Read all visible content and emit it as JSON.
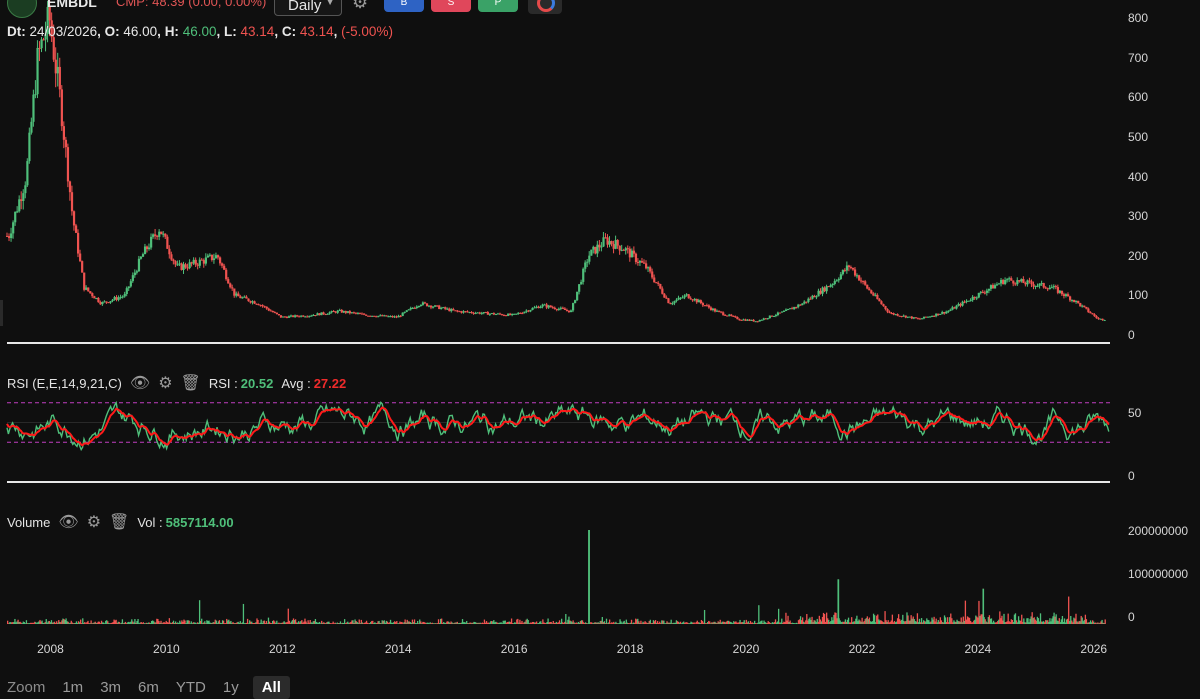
{
  "header": {
    "symbol": "EMBDL",
    "cmp_text": "CMP: 48.39 (0.00, 0.00%)",
    "timeframe": "Daily",
    "buttons": [
      "B",
      "S",
      "P"
    ]
  },
  "ohlc": {
    "dt_label": "Dt:",
    "dt": "24/03/2026",
    "o_label": "O:",
    "o": "46.00",
    "h_label": "H:",
    "h": "46.00",
    "l_label": "L:",
    "l": "43.14",
    "c_label": "C:",
    "c": "43.14",
    "change": "(-5.00%)"
  },
  "rsi": {
    "label": "RSI (E,E,14,9,21,C)",
    "value_label": "RSI :",
    "value": "20.52",
    "avg_label": "Avg :",
    "avg": "27.22"
  },
  "volume": {
    "label": "Volume",
    "value_label": "Vol :",
    "value": "5857114.00"
  },
  "zoom": {
    "label": "Zoom",
    "options": [
      "1m",
      "3m",
      "6m",
      "YTD",
      "1y",
      "All"
    ],
    "active": "All"
  },
  "colors": {
    "up": "#4fbf7a",
    "down": "#ef5350",
    "rsi_line": "#ff1a1a",
    "band": "#c03fc0"
  },
  "chart_data": [
    {
      "type": "line",
      "title": "EMBDL price",
      "x": [
        2007.3,
        2007.6,
        2007.8,
        2008.0,
        2008.2,
        2008.4,
        2008.6,
        2008.9,
        2009.3,
        2009.6,
        2009.9,
        2010.2,
        2010.5,
        2010.9,
        2011.2,
        2011.6,
        2012.0,
        2012.5,
        2013.0,
        2013.5,
        2014.0,
        2014.4,
        2015.0,
        2015.5,
        2016.0,
        2016.5,
        2017.0,
        2017.3,
        2017.6,
        2017.9,
        2018.3,
        2018.7,
        2019.0,
        2019.5,
        2019.9,
        2020.2,
        2020.7,
        2021.0,
        2021.5,
        2021.8,
        2022.1,
        2022.5,
        2023.0,
        2023.5,
        2024.0,
        2024.5,
        2024.9,
        2025.3,
        2025.7,
        2026.1
      ],
      "y": [
        250,
        400,
        700,
        800,
        580,
        300,
        120,
        80,
        100,
        200,
        270,
        170,
        180,
        200,
        100,
        80,
        45,
        50,
        60,
        50,
        45,
        80,
        60,
        55,
        50,
        75,
        60,
        200,
        240,
        220,
        170,
        80,
        100,
        60,
        40,
        35,
        60,
        80,
        130,
        175,
        120,
        55,
        40,
        60,
        100,
        140,
        130,
        120,
        85,
        40
      ],
      "ylim": [
        0,
        850
      ],
      "yticks": [
        "0",
        "100",
        "200",
        "300",
        "400",
        "500",
        "600",
        "700",
        "800"
      ]
    },
    {
      "type": "line",
      "title": "RSI",
      "yticks": [
        "0",
        "50"
      ],
      "bands": [
        30,
        70
      ],
      "ylim": [
        0,
        100
      ]
    },
    {
      "type": "bar",
      "title": "Volume",
      "yticks": [
        "0",
        "100000000",
        "200000000"
      ],
      "ylim": [
        0,
        220000000
      ],
      "spikes": [
        {
          "x": 2017.3,
          "y": 200000000
        },
        {
          "x": 2021.6,
          "y": 95000000
        },
        {
          "x": 2024.1,
          "y": 75000000
        }
      ]
    }
  ],
  "x_axis": {
    "ticks": [
      "2008",
      "2010",
      "2012",
      "2014",
      "2016",
      "2018",
      "2020",
      "2022",
      "2024",
      "2026"
    ]
  }
}
